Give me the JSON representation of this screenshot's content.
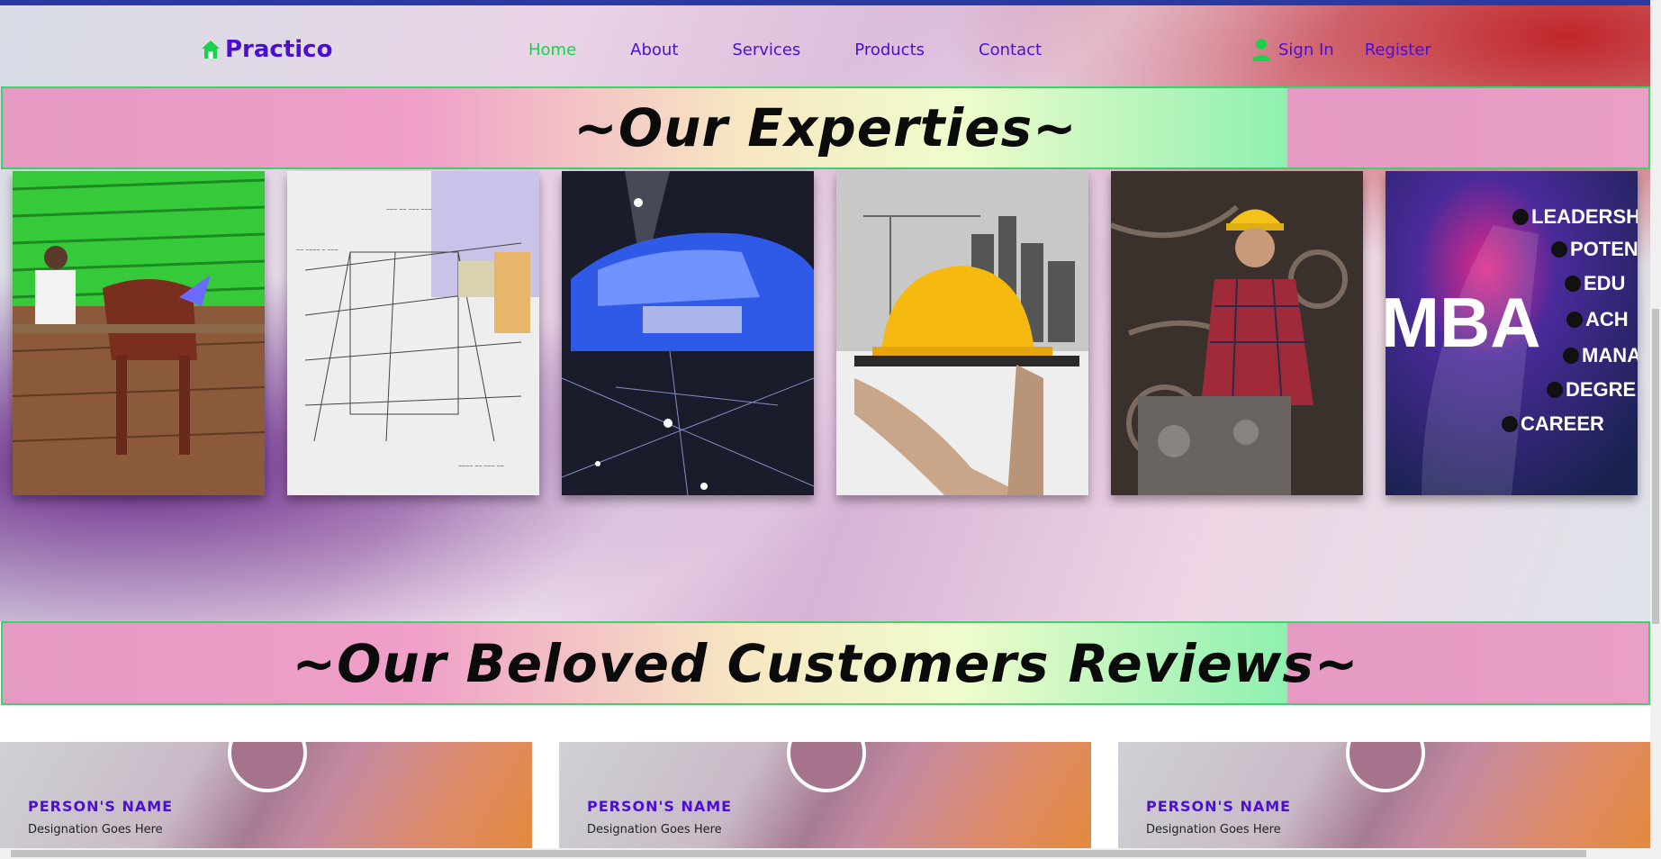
{
  "navbar": {
    "brand": "Practico",
    "links": [
      {
        "label": "Home",
        "active": true
      },
      {
        "label": "About"
      },
      {
        "label": "Services"
      },
      {
        "label": "Products"
      },
      {
        "label": "Contact"
      }
    ],
    "sign_in": "Sign In",
    "register": "Register"
  },
  "experties": {
    "title": "~Our Experties~",
    "images": [
      {
        "name": "agriculture-image"
      },
      {
        "name": "architecture-image"
      },
      {
        "name": "automobile-image"
      },
      {
        "name": "construction-image"
      },
      {
        "name": "mechanical-image"
      },
      {
        "name": "mba-image",
        "labels": [
          "LEADERSH",
          "POTEN",
          "EDU",
          "ACH",
          "MANA",
          "DEGRE",
          "CAREER"
        ],
        "big_text": "MBA"
      }
    ]
  },
  "reviews": {
    "title": "~Our Beloved Customers Reviews~",
    "cards": [
      {
        "name": "PERSON'S NAME",
        "designation": "Designation Goes Here"
      },
      {
        "name": "PERSON'S NAME",
        "designation": "Designation Goes Here"
      },
      {
        "name": "PERSON'S NAME",
        "designation": "Designation Goes Here"
      }
    ]
  },
  "colors": {
    "brand": "#4b0fd4",
    "active": "#19d14a",
    "banner_border": "#3ed36a"
  }
}
